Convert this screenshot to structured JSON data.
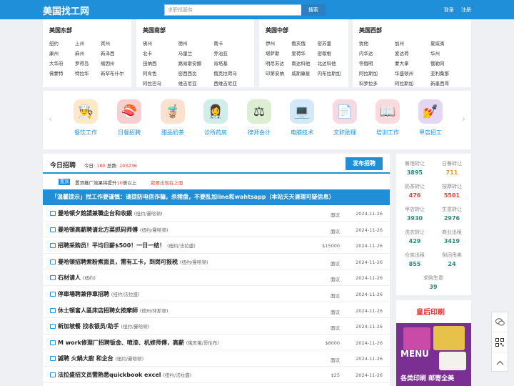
{
  "header": {
    "logo": "美国找工网",
    "search_placeholder": "求职找服务",
    "search_button": "搜索",
    "login": "登录",
    "register": "注册"
  },
  "regions": [
    {
      "title": "美国东部",
      "cities": [
        "纽约",
        "上州",
        "宾州",
        "康州",
        "麻州",
        "新泽西",
        "大华府",
        "罗得岛",
        "缅因州",
        "佛蒙特",
        "特拉华",
        "新罕布什尔"
      ]
    },
    {
      "title": "美国南部",
      "cities": [
        "佛州",
        "德州",
        "南卡",
        "北卡",
        "马里兰",
        "乔治亚",
        "田纳西",
        "路易斯安娜",
        "肯塔基",
        "阿肯色",
        "密西西比",
        "俄克拉荷马",
        "阿拉巴马",
        "维吉尼亚",
        "西维吉尼亚"
      ]
    },
    {
      "title": "美国中部",
      "cities": [
        "伊州",
        "俄亥俄",
        "密苏里",
        "堪萨斯",
        "爱荷华",
        "密歇根",
        "明尼苏达",
        "南达科他",
        "北达科他",
        "印第安纳",
        "威斯康星",
        "内布拉斯加"
      ]
    },
    {
      "title": "美国西部",
      "cities": [
        "犹他",
        "加州",
        "夏威夷",
        "内华达",
        "爱达荷",
        "华州",
        "怀俄明",
        "蒙大拿",
        "俄勒冈",
        "阿拉斯加",
        "华盛顿州",
        "亚利桑那",
        "科罗拉多",
        "阿拉斯加",
        "新墨西哥"
      ]
    }
  ],
  "categories": [
    {
      "label": "餐饮工作",
      "icon": "chef-icon",
      "glyph": "👨‍🍳",
      "bg": "#fbe9c9"
    },
    {
      "label": "日餐招聘",
      "icon": "sushi-chef-icon",
      "glyph": "🍣",
      "bg": "#f6d0d0"
    },
    {
      "label": "甜品奶茶",
      "icon": "waitress-icon",
      "glyph": "🧋",
      "bg": "#fbe2cf"
    },
    {
      "label": "诊所药房",
      "icon": "nurse-icon",
      "glyph": "👩‍⚕️",
      "bg": "#cfeee9"
    },
    {
      "label": "律师会计",
      "icon": "gavel-icon",
      "glyph": "⚖",
      "bg": "#dcefd2"
    },
    {
      "label": "电脑技术",
      "icon": "programmer-icon",
      "glyph": "💻",
      "bg": "#d3e8f8"
    },
    {
      "label": "文职助理",
      "icon": "document-icon",
      "glyph": "📄",
      "bg": "#f8d9e2"
    },
    {
      "label": "培训工作",
      "icon": "book-icon",
      "glyph": "📖",
      "bg": "#f9dadf"
    },
    {
      "label": "甲店招工",
      "icon": "nail-icon",
      "glyph": "💅",
      "bg": "#e3d7f3"
    }
  ],
  "jobs": {
    "title": "今日招聘",
    "today_label": "今日:",
    "today_count": "160",
    "total_label": "总数:",
    "total_count": "203236",
    "post_button": "发布招聘",
    "pin_badge": "置顶",
    "pin_text_1": "置顶推广效果将提升",
    "pin_times": "10",
    "pin_text_2": "倍以上",
    "pin_link": "我要出现在上面",
    "notice": "「温馨提示」找工作要谨慎：请提防电信诈骗，杀猪盘，不要乱加line和wahtsapp（本站天天清理可疑信息）",
    "rows": [
      {
        "title": "曼哈顿夕館請兼職企台和收銀",
        "loc": "(纽约/曼哈顿)",
        "salary": "面议",
        "date": "2024-11-26"
      },
      {
        "title": "曼哈顿高薪聘请北方菜抓码师傅",
        "loc": "(纽约/曼哈顿)",
        "salary": "面议",
        "date": "2024-11-26"
      },
      {
        "title": "招聘采购员！平均日薪$500！一日一结！",
        "loc": "(纽约/法拉盛)",
        "salary": "$15000",
        "date": "2024-11-26"
      },
      {
        "title": "曼哈顿招聘煮粉煮面员，需有工卡，到岗可报税",
        "loc": "(纽约/曼哈顿)",
        "salary": "面议",
        "date": "2024-11-26"
      },
      {
        "title": "石材请人",
        "loc": "(纽约)",
        "salary": "面议",
        "date": "2024-11-26"
      },
      {
        "title": "停車場聘兼停車招聘",
        "loc": "(纽约/法拉盛)",
        "salary": "面议",
        "date": "2024-11-26"
      },
      {
        "title": "休士顿富人區床店招聘女按摩師",
        "loc": "(德州/休斯顿)",
        "salary": "面议",
        "date": "2024-11-26"
      },
      {
        "title": "新加坡餐 找收银员/助手",
        "loc": "(纽约/曼哈顿)",
        "salary": "面议",
        "date": "2024-11-26"
      },
      {
        "title": "M work修理厂招聘钣金、喷漆、机修师傅，高薪",
        "loc": "(俄亥俄/哥伦布)",
        "salary": "$8000",
        "date": "2024-11-26"
      },
      {
        "title": "誠聘 火鍋大廚 和企台",
        "loc": "(纽约/曼哈顿)",
        "salary": "面议",
        "date": "2024-11-26"
      },
      {
        "title": "法拉盛招文员需熟悉quickbook excel",
        "loc": "(纽约/法拉盛)",
        "salary": "$25",
        "date": "2024-11-26"
      }
    ]
  },
  "stats": [
    {
      "label": "餐馆转让",
      "value": "3895",
      "color": "#2a8c7a"
    },
    {
      "label": "日餐转让",
      "value": "711",
      "color": "#d99a1c"
    },
    {
      "label": "奶茶转让",
      "value": "476",
      "color": "#e0453a"
    },
    {
      "label": "按摩转让",
      "value": "5501",
      "color": "#e0453a"
    },
    {
      "label": "甲店转让",
      "value": "3930",
      "color": "#2a8c7a"
    },
    {
      "label": "生意转让",
      "value": "2976",
      "color": "#2a8c7a"
    },
    {
      "label": "洗衣转让",
      "value": "429",
      "color": "#2a8c7a"
    },
    {
      "label": "商业出租",
      "value": "3419",
      "color": "#2a8c7a"
    },
    {
      "label": "仓库出租",
      "value": "855",
      "color": "#2a8c7a"
    },
    {
      "label": "例闭甩卖",
      "value": "24",
      "color": "#2a8c7a"
    },
    {
      "label": "求购生意",
      "value": "39",
      "color": "#2a8c7a"
    }
  ],
  "ad": {
    "brand": "皇后印刷",
    "menu": "MENU",
    "subtitle": "各类印刷 邮寄全美"
  }
}
